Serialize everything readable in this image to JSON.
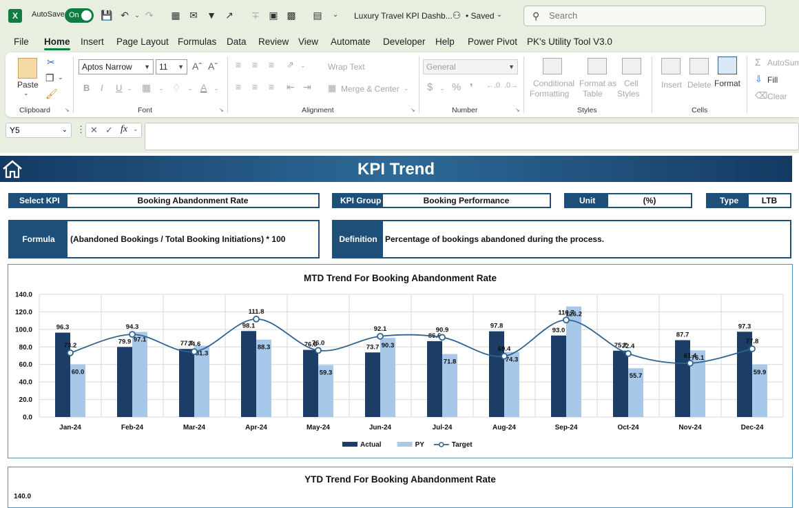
{
  "titlebar": {
    "autosave_label": "AutoSave",
    "autosave_state": "On",
    "doc_title": "Luxury Travel KPI Dashb...",
    "saved_status": "• Saved",
    "search_placeholder": "Search"
  },
  "tabs": [
    "File",
    "Home",
    "Insert",
    "Page Layout",
    "Formulas",
    "Data",
    "Review",
    "View",
    "Automate",
    "Developer",
    "Help",
    "Power Pivot",
    "PK's Utility Tool V3.0"
  ],
  "active_tab": "Home",
  "ribbon": {
    "clipboard": {
      "label": "Clipboard",
      "paste": "Paste"
    },
    "font": {
      "label": "Font",
      "font_name": "Aptos Narrow",
      "font_size": "11"
    },
    "alignment": {
      "label": "Alignment",
      "wrap_text": "Wrap Text",
      "merge_center": "Merge & Center"
    },
    "number": {
      "label": "Number",
      "format": "General"
    },
    "styles": {
      "label": "Styles",
      "conditional_1": "Conditional",
      "conditional_2": "Formatting",
      "format_table_1": "Format as",
      "format_table_2": "Table",
      "cell_styles_1": "Cell",
      "cell_styles_2": "Styles"
    },
    "cells": {
      "label": "Cells",
      "insert": "Insert",
      "delete": "Delete",
      "format": "Format"
    },
    "editing": {
      "autosum": "AutoSum",
      "fill": "Fill",
      "clear": "Clear"
    }
  },
  "formula_bar": {
    "name_box": "Y5",
    "formula": ""
  },
  "sheet": {
    "banner_title": "KPI Trend",
    "select_kpi": {
      "label": "Select KPI",
      "value": "Booking Abandonment Rate"
    },
    "kpi_group": {
      "label": "KPI Group",
      "value": "Booking Performance"
    },
    "unit": {
      "label": "Unit",
      "value": "(%)"
    },
    "type": {
      "label": "Type",
      "value": "LTB"
    },
    "formula": {
      "label": "Formula",
      "value": "(Abandoned Bookings / Total Booking Initiations) * 100"
    },
    "definition": {
      "label": "Definition",
      "value": "Percentage of bookings abandoned during the process."
    },
    "ytd_title": "YTD Trend For Booking Abandonment Rate",
    "ytd_first_tick": "140.0"
  },
  "chart_data": {
    "type": "bar",
    "title": "MTD Trend For Booking Abandonment Rate",
    "categories": [
      "Jan-24",
      "Feb-24",
      "Mar-24",
      "Apr-24",
      "May-24",
      "Jun-24",
      "Jul-24",
      "Aug-24",
      "Sep-24",
      "Oct-24",
      "Nov-24",
      "Dec-24"
    ],
    "series": [
      {
        "name": "Actual",
        "type": "bar",
        "color": "#1b3d66",
        "values": [
          96.3,
          79.9,
          77.7,
          98.1,
          76.6,
          73.7,
          86.6,
          97.8,
          93.0,
          75.7,
          87.7,
          97.3
        ]
      },
      {
        "name": "PY",
        "type": "bar",
        "color": "#a8c8ea",
        "values": [
          60.0,
          97.1,
          81.3,
          88.3,
          59.3,
          90.3,
          71.8,
          74.3,
          126.2,
          55.7,
          76.1,
          59.9
        ]
      },
      {
        "name": "Target",
        "type": "line",
        "color": "#2f6391",
        "values": [
          73.2,
          94.3,
          74.6,
          111.8,
          76.0,
          92.1,
          90.9,
          69.4,
          110.7,
          72.4,
          61.4,
          77.8
        ]
      }
    ],
    "yticks": [
      "140.0",
      "120.0",
      "100.0",
      "80.0",
      "60.0",
      "40.0",
      "20.0",
      "0.0"
    ],
    "ylim": [
      0,
      140
    ],
    "grid": true,
    "legend": "bottom"
  }
}
